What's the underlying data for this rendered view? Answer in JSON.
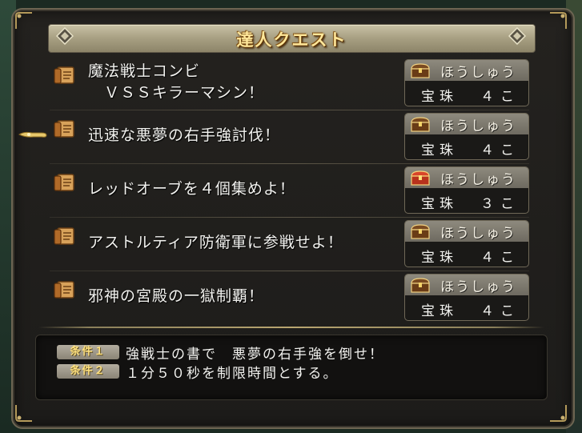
{
  "title": "達人クエスト",
  "colors": {
    "title_gold": "#ffe79a",
    "reward_bar": "#8e8a7e",
    "panel_bg": "#1d1c1a"
  },
  "quests": [
    {
      "name": "魔法戦士コンビ\n　ＶＳＳキラーマシン！",
      "reward_label": "ほうしゅう",
      "reward_item": "宝珠",
      "reward_qty": "４こ",
      "chest_icon": "wooden-chest-icon"
    },
    {
      "name": "迅速な悪夢の右手強討伐！",
      "reward_label": "ほうしゅう",
      "reward_item": "宝珠",
      "reward_qty": "４こ",
      "chest_icon": "wooden-chest-icon"
    },
    {
      "name": "レッドオーブを４個集めよ！",
      "reward_label": "ほうしゅう",
      "reward_item": "宝珠",
      "reward_qty": "３こ",
      "chest_icon": "red-chest-icon"
    },
    {
      "name": "アストルティア防衛軍に参戦せよ！",
      "reward_label": "ほうしゅう",
      "reward_item": "宝珠",
      "reward_qty": "４こ",
      "chest_icon": "wooden-chest-icon"
    },
    {
      "name": "邪神の宮殿の一獄制覇！",
      "reward_label": "ほうしゅう",
      "reward_item": "宝珠",
      "reward_qty": "４こ",
      "chest_icon": "wooden-chest-icon"
    }
  ],
  "conditions": [
    {
      "badge": "条件１",
      "text": "強戦士の書で　悪夢の右手強を倒せ！"
    },
    {
      "badge": "条件２",
      "text": "１分５０秒を制限時間とする。"
    }
  ]
}
